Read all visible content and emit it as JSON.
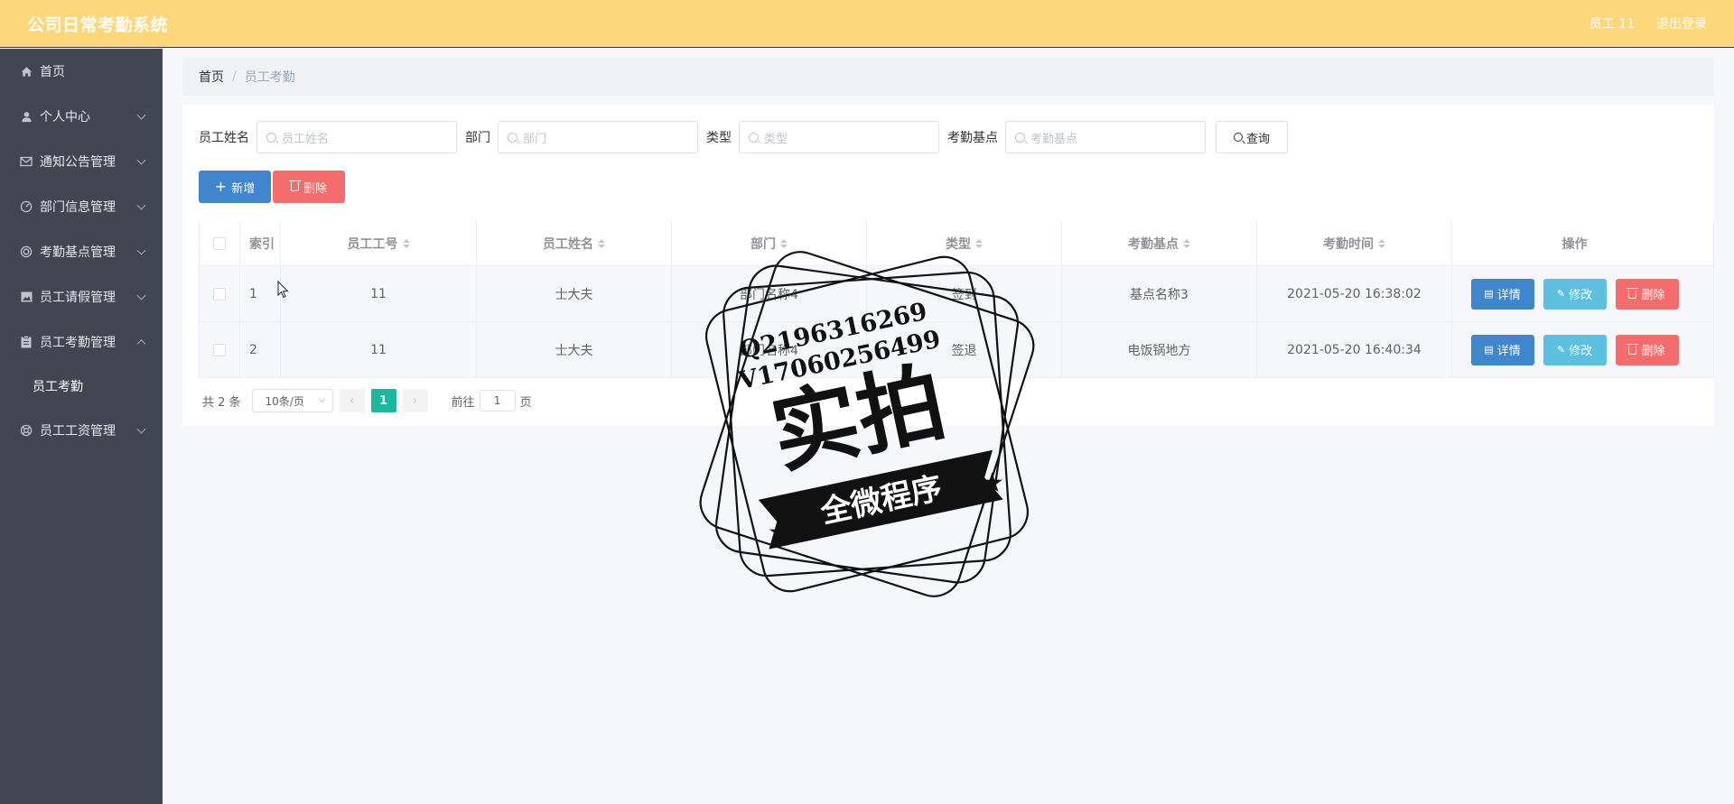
{
  "app": {
    "title": "公司日常考勤系统"
  },
  "topbar": {
    "user": "员工 11",
    "logout": "退出登录"
  },
  "sidebar": {
    "items": [
      {
        "label": "首页",
        "icon": "home-icon"
      },
      {
        "label": "个人中心",
        "icon": "user-icon"
      },
      {
        "label": "通知公告管理",
        "icon": "mail-icon"
      },
      {
        "label": "部门信息管理",
        "icon": "gauge-icon"
      },
      {
        "label": "考勤基点管理",
        "icon": "target-icon"
      },
      {
        "label": "员工请假管理",
        "icon": "picture-icon"
      },
      {
        "label": "员工考勤管理",
        "icon": "clipboard-icon"
      },
      {
        "label": "员工工资管理",
        "icon": "life-ring-icon"
      }
    ],
    "sub_item": "员工考勤"
  },
  "breadcrumb": {
    "home": "首页",
    "separator": "/",
    "current": "员工考勤"
  },
  "search": {
    "name_label": "员工姓名",
    "name_placeholder": "员工姓名",
    "dept_label": "部门",
    "dept_placeholder": "部门",
    "type_label": "类型",
    "type_placeholder": "类型",
    "base_label": "考勤基点",
    "base_placeholder": "考勤基点",
    "query_button": "查询"
  },
  "actions": {
    "add": "新增",
    "delete": "删除"
  },
  "table": {
    "headers": [
      "索引",
      "员工工号",
      "员工姓名",
      "部门",
      "类型",
      "考勤基点",
      "考勤时间",
      "操作"
    ],
    "rows": [
      {
        "index": "1",
        "emp_no": "11",
        "name": "士大夫",
        "dept": "部门名称4",
        "type": "签到",
        "base": "基点名称3",
        "time": "2021-05-20 16:38:02"
      },
      {
        "index": "2",
        "emp_no": "11",
        "name": "士大夫",
        "dept": "部门名称4",
        "type": "签退",
        "base": "电饭锅地方",
        "time": "2021-05-20 16:40:34"
      }
    ],
    "op_labels": {
      "detail": "详情",
      "edit": "修改",
      "delete": "删除"
    }
  },
  "pager": {
    "total": "共 2 条",
    "page_size": "10条/页",
    "current_page": "1",
    "goto_prefix": "前往",
    "goto_value": "1",
    "goto_suffix": "页",
    "prev": "‹",
    "next": "›"
  },
  "watermark": {
    "line1": "Q2196316269",
    "line2": "V17060256499",
    "big": "实拍",
    "banner": "全微程序"
  }
}
